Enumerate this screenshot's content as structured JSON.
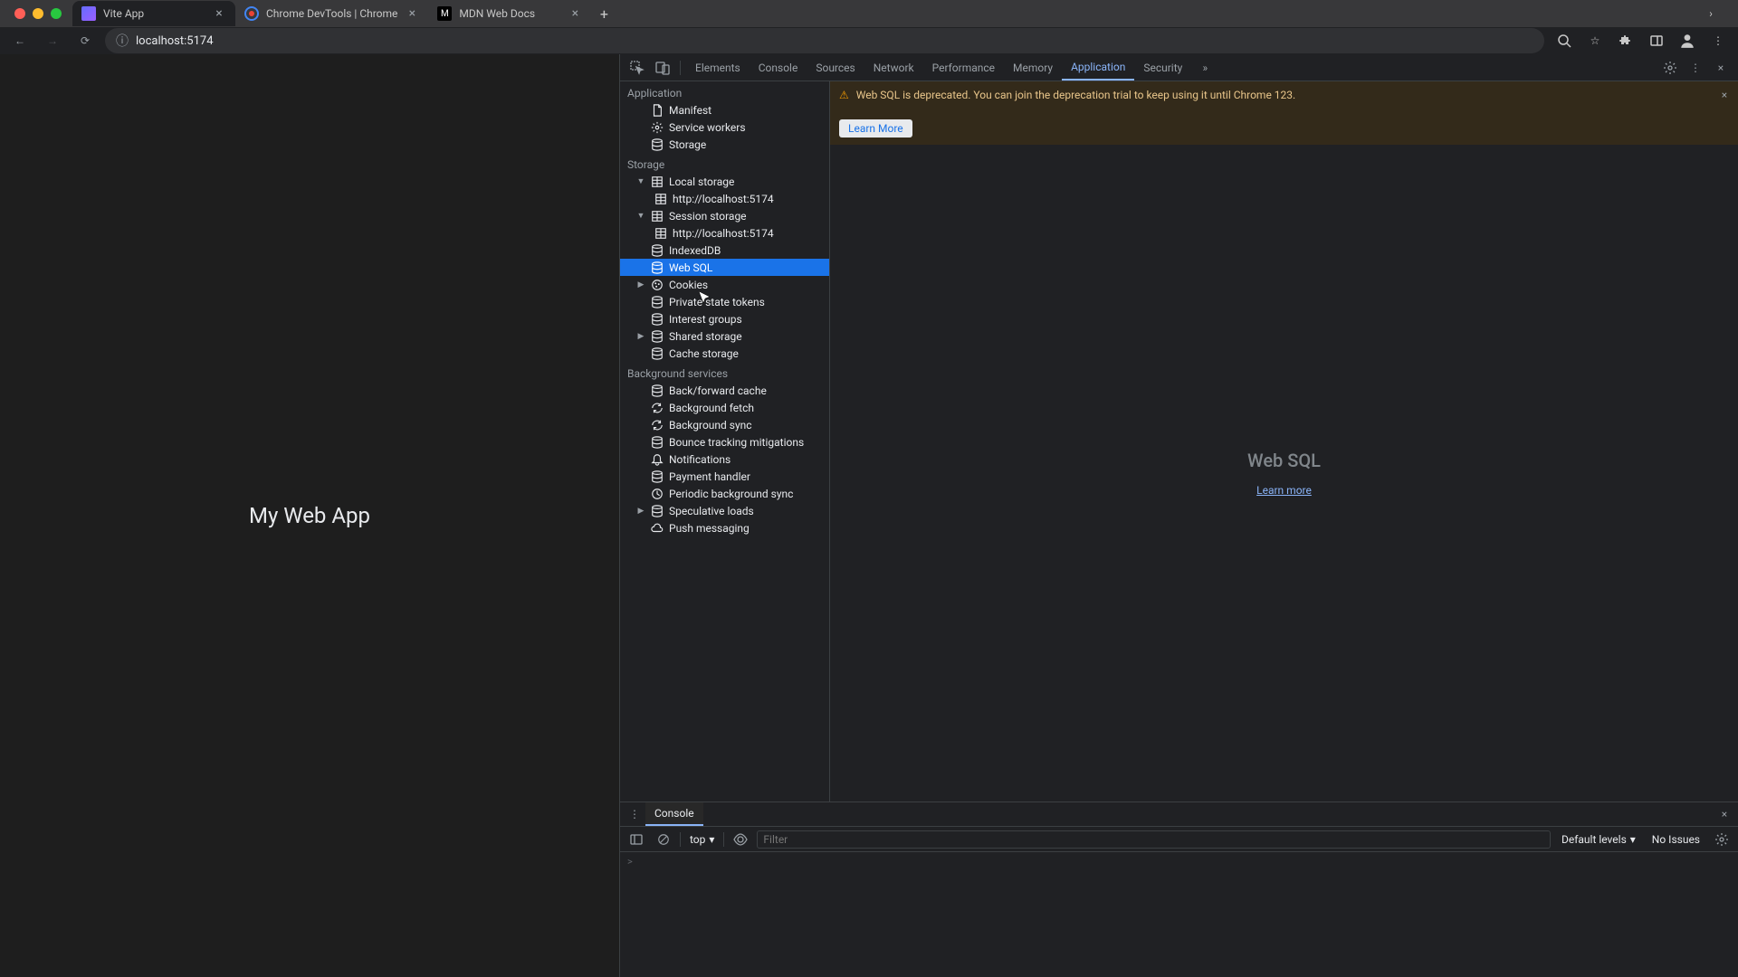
{
  "browser": {
    "tabs": [
      {
        "title": "Vite App",
        "favicon": "#646cff",
        "favicon_text": "V"
      },
      {
        "title": "Chrome DevTools | Chrome",
        "favicon": "#4285f4",
        "favicon_text": "◐"
      },
      {
        "title": "MDN Web Docs",
        "favicon": "#000",
        "favicon_text": "M"
      }
    ],
    "url": "localhost:5174"
  },
  "page": {
    "heading": "My Web App"
  },
  "devtools": {
    "tabs": [
      "Elements",
      "Console",
      "Sources",
      "Network",
      "Performance",
      "Memory",
      "Application",
      "Security"
    ],
    "active_tab": "Application",
    "sidebar": {
      "sections": [
        {
          "title": "Application",
          "items": [
            {
              "label": "Manifest",
              "icon": "doc"
            },
            {
              "label": "Service workers",
              "icon": "gear"
            },
            {
              "label": "Storage",
              "icon": "db"
            }
          ]
        },
        {
          "title": "Storage",
          "items": [
            {
              "label": "Local storage",
              "icon": "table",
              "arrow": "down",
              "children": [
                {
                  "label": "http://localhost:5174",
                  "icon": "table"
                }
              ]
            },
            {
              "label": "Session storage",
              "icon": "table",
              "arrow": "down",
              "children": [
                {
                  "label": "http://localhost:5174",
                  "icon": "table"
                }
              ]
            },
            {
              "label": "IndexedDB",
              "icon": "db"
            },
            {
              "label": "Web SQL",
              "icon": "db",
              "selected": true
            },
            {
              "label": "Cookies",
              "icon": "cookie",
              "arrow": "right"
            },
            {
              "label": "Private state tokens",
              "icon": "db"
            },
            {
              "label": "Interest groups",
              "icon": "db"
            },
            {
              "label": "Shared storage",
              "icon": "db",
              "arrow": "right"
            },
            {
              "label": "Cache storage",
              "icon": "db"
            }
          ]
        },
        {
          "title": "Background services",
          "items": [
            {
              "label": "Back/forward cache",
              "icon": "db"
            },
            {
              "label": "Background fetch",
              "icon": "sync"
            },
            {
              "label": "Background sync",
              "icon": "sync"
            },
            {
              "label": "Bounce tracking mitigations",
              "icon": "db"
            },
            {
              "label": "Notifications",
              "icon": "bell"
            },
            {
              "label": "Payment handler",
              "icon": "db"
            },
            {
              "label": "Periodic background sync",
              "icon": "clock"
            },
            {
              "label": "Speculative loads",
              "icon": "db",
              "arrow": "right"
            },
            {
              "label": "Push messaging",
              "icon": "cloud"
            }
          ]
        }
      ]
    },
    "warning": {
      "text": "Web SQL is deprecated. You can join the deprecation trial to keep using it until Chrome 123.",
      "button": "Learn More"
    },
    "main": {
      "title": "Web SQL",
      "link": "Learn more"
    },
    "drawer": {
      "tab": "Console",
      "context": "top",
      "filter_placeholder": "Filter",
      "levels": "Default levels",
      "issues": "No Issues",
      "prompt": ">"
    }
  },
  "colors": {
    "red": "#ff5f57",
    "yellow": "#febc2e",
    "green": "#28c840"
  }
}
